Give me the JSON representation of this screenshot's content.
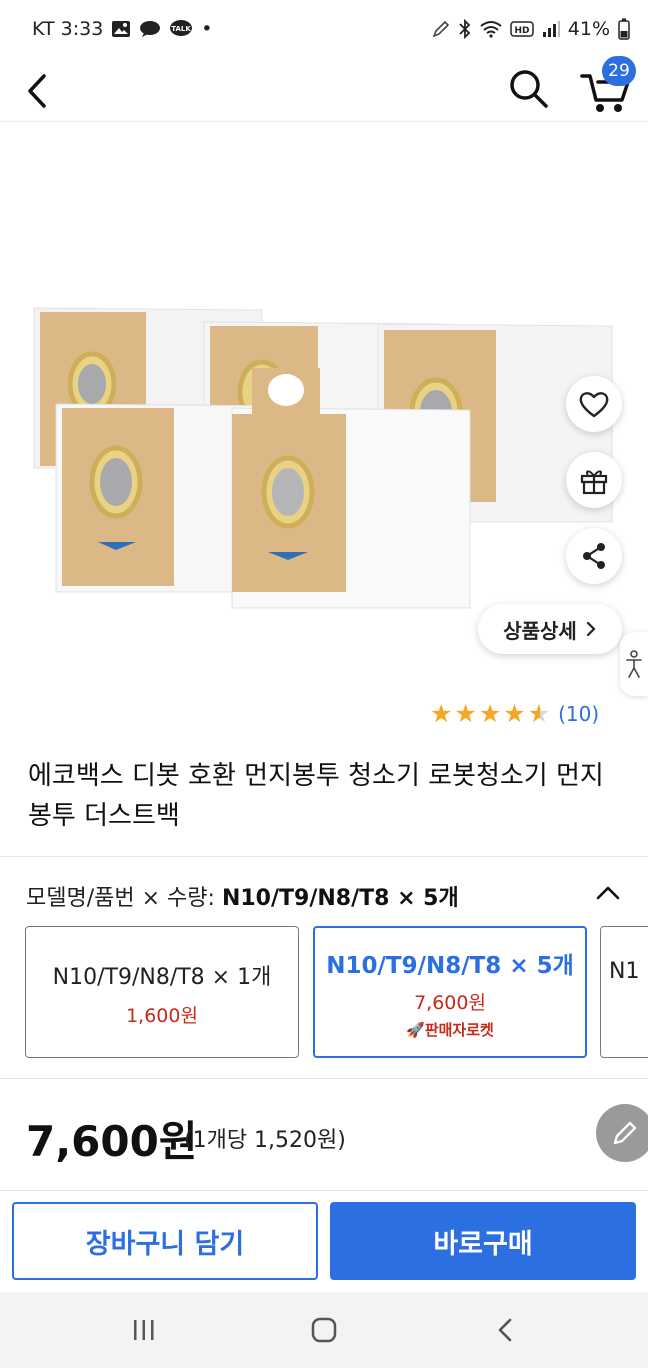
{
  "status_bar": {
    "carrier_time": "KT 3:33",
    "dot": "•",
    "battery": "41%",
    "talk_badge": "TALK",
    "hd_badge": "HD"
  },
  "header": {
    "cart_count": "29"
  },
  "product": {
    "detail_button_label": "상품상세",
    "rating_count": "(10)",
    "rating_value": 4.5,
    "title": "에코백스 디봇 호환 먼지봉투 청소기 로봇청소기 먼지봉투 더스트백"
  },
  "option": {
    "label_prefix": "모델명/품번 × 수량:",
    "selected_value": "N10/T9/N8/T8 × 5개",
    "cards": [
      {
        "name": "N10/T9/N8/T8 × 1개",
        "price": "1,600원"
      },
      {
        "name": "N10/T9/N8/T8 × 5개",
        "price": "7,600원",
        "badge": "판매자로켓"
      },
      {
        "name": "N1"
      }
    ]
  },
  "price": {
    "total": "7,600원",
    "unit": "(1개당 1,520원)"
  },
  "actions": {
    "add_to_cart": "장바구니 담기",
    "buy_now": "바로구매"
  },
  "colors": {
    "brand_blue": "#2b6fe0",
    "price_red": "#c8291b",
    "star": "#f5a623"
  }
}
